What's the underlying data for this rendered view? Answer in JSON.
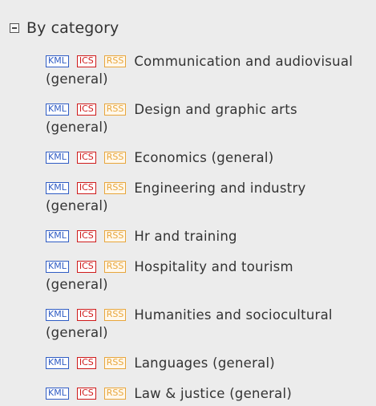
{
  "section": {
    "title": "By category"
  },
  "badges": {
    "kml": "KML",
    "ics": "ICS",
    "rss": "RSS"
  },
  "categories": [
    {
      "label": "Communication and audiovisual (general)"
    },
    {
      "label": "Design and graphic arts (general)"
    },
    {
      "label": "Economics (general)"
    },
    {
      "label": "Engineering and industry (general)"
    },
    {
      "label": "Hr and training"
    },
    {
      "label": "Hospitality and tourism (general)"
    },
    {
      "label": "Humanities and sociocultural (general)"
    },
    {
      "label": "Languages (general)"
    },
    {
      "label": "Law & justice (general)"
    }
  ],
  "colors": {
    "kml": "#2f5cc4",
    "ics": "#cf1b1b",
    "rss": "#e8a63c",
    "text": "#333333",
    "background": "#ececec"
  }
}
